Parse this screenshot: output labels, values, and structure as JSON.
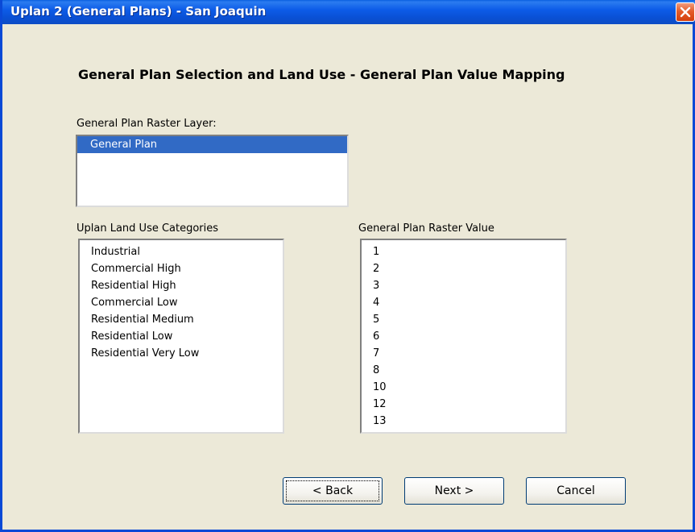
{
  "window": {
    "title": "Uplan 2 (General Plans) - San Joaquin"
  },
  "heading": "General Plan Selection and Land Use - General Plan Value Mapping",
  "raster_layer": {
    "label": "General Plan Raster Layer:",
    "items": [
      "General Plan"
    ],
    "selected": "General Plan"
  },
  "land_use": {
    "label": "Uplan Land Use Categories",
    "items": [
      "Industrial",
      "Commercial High",
      "Residential High",
      "Commercial Low",
      "Residential Medium",
      "Residential Low",
      "Residential Very Low"
    ]
  },
  "raster_value": {
    "label": "General Plan Raster Value",
    "items": [
      "1",
      "2",
      "3",
      "4",
      "5",
      "6",
      "7",
      "8",
      "10",
      "12",
      "13"
    ]
  },
  "buttons": {
    "back": "< Back",
    "next": "Next >",
    "cancel": "Cancel"
  },
  "icons": {
    "close": "close-icon"
  },
  "colors": {
    "titlebar": "#0a51d6",
    "selection": "#316ac5",
    "close_button": "#e45c2a",
    "dialog_background": "#ece9d8"
  }
}
